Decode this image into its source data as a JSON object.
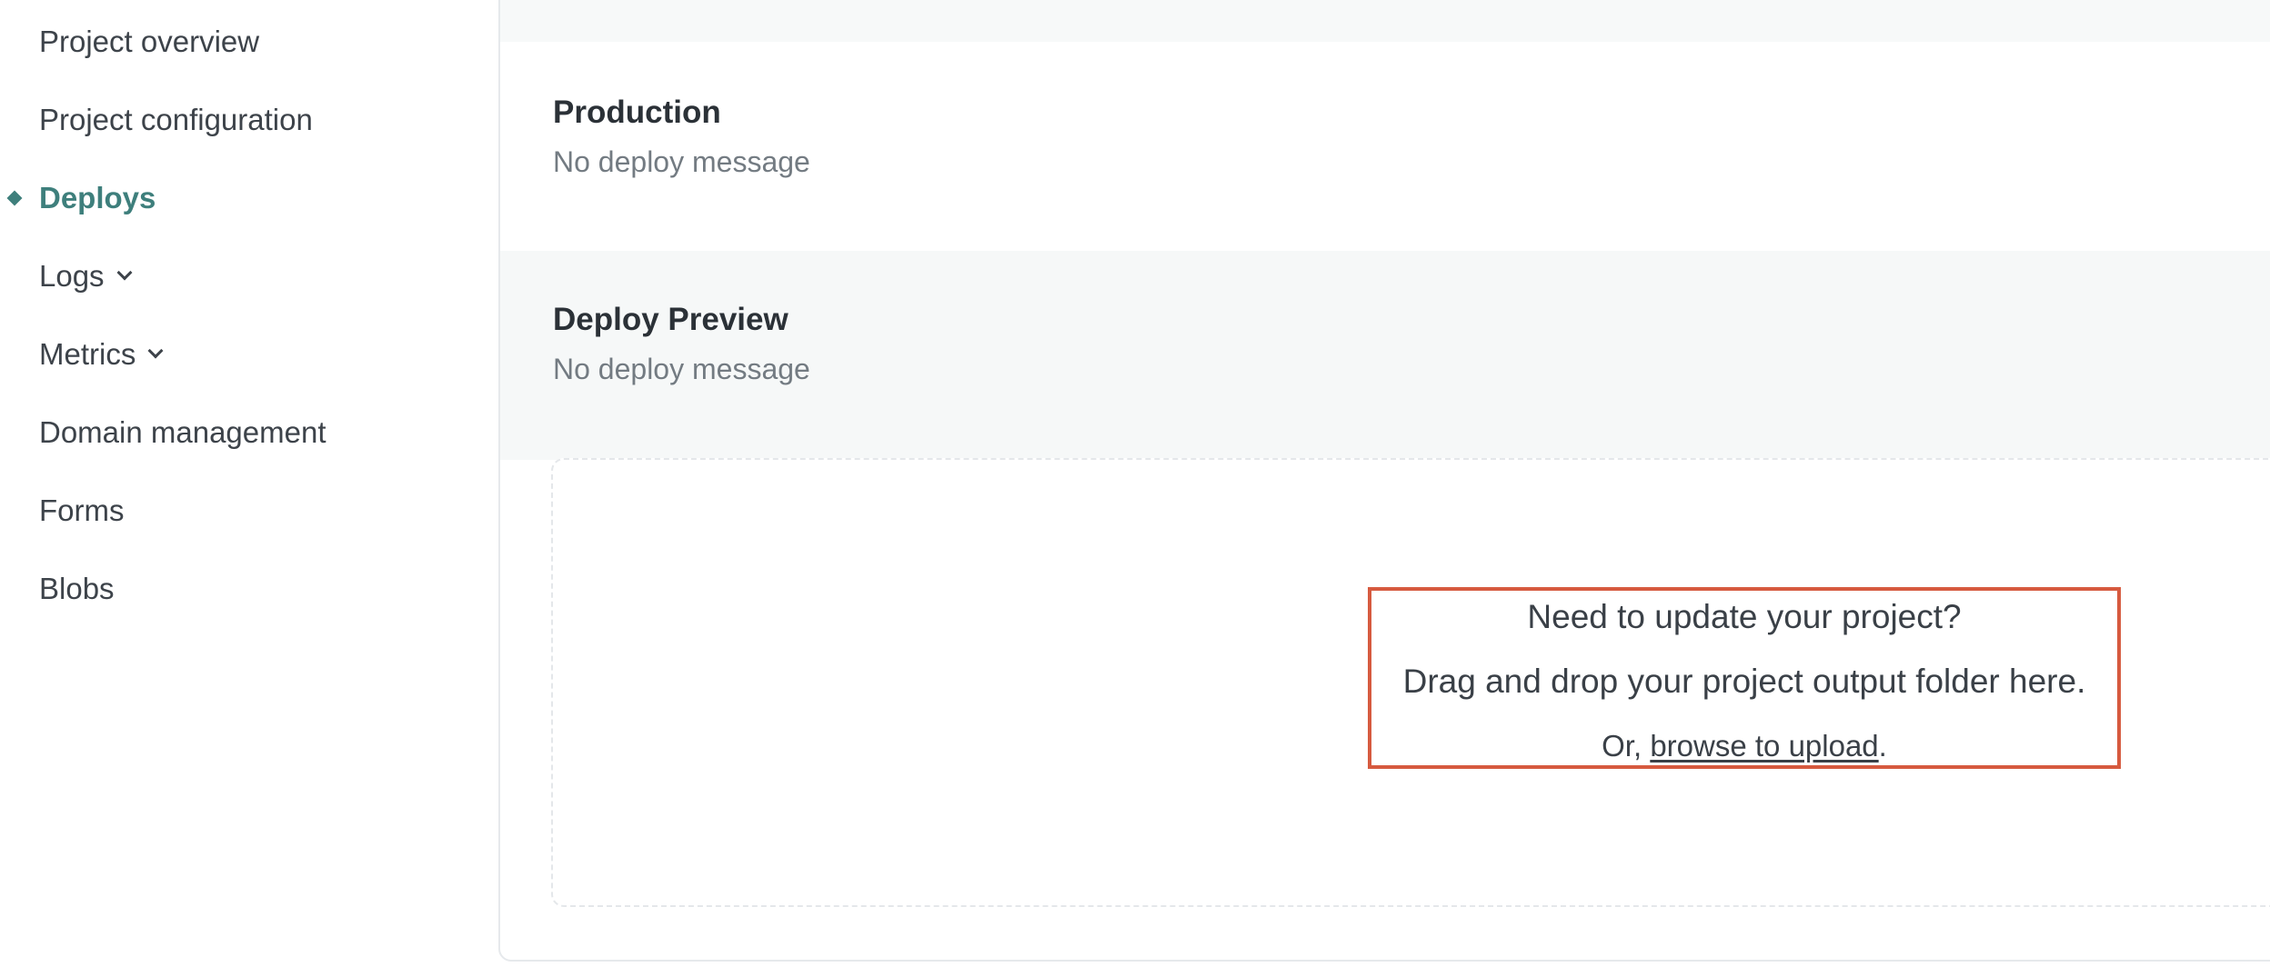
{
  "sidebar": {
    "items": [
      {
        "label": "Project overview"
      },
      {
        "label": "Project configuration"
      },
      {
        "label": "Deploys"
      },
      {
        "label": "Logs"
      },
      {
        "label": "Metrics"
      },
      {
        "label": "Domain management"
      },
      {
        "label": "Forms"
      },
      {
        "label": "Blobs"
      }
    ],
    "active_item": "Deploys"
  },
  "main": {
    "production": {
      "title": "Production",
      "message": "No deploy message"
    },
    "deploy_preview": {
      "title": "Deploy Preview",
      "message": "No deploy message"
    },
    "dropzone": {
      "heading": "Need to update your project?",
      "instruction": "Drag and drop your project output folder here.",
      "prefix": "Or, ",
      "link_label": "browse to upload",
      "suffix": "."
    }
  },
  "colors": {
    "accent": "#3e7f7c",
    "highlight_border": "#d65a3f"
  }
}
